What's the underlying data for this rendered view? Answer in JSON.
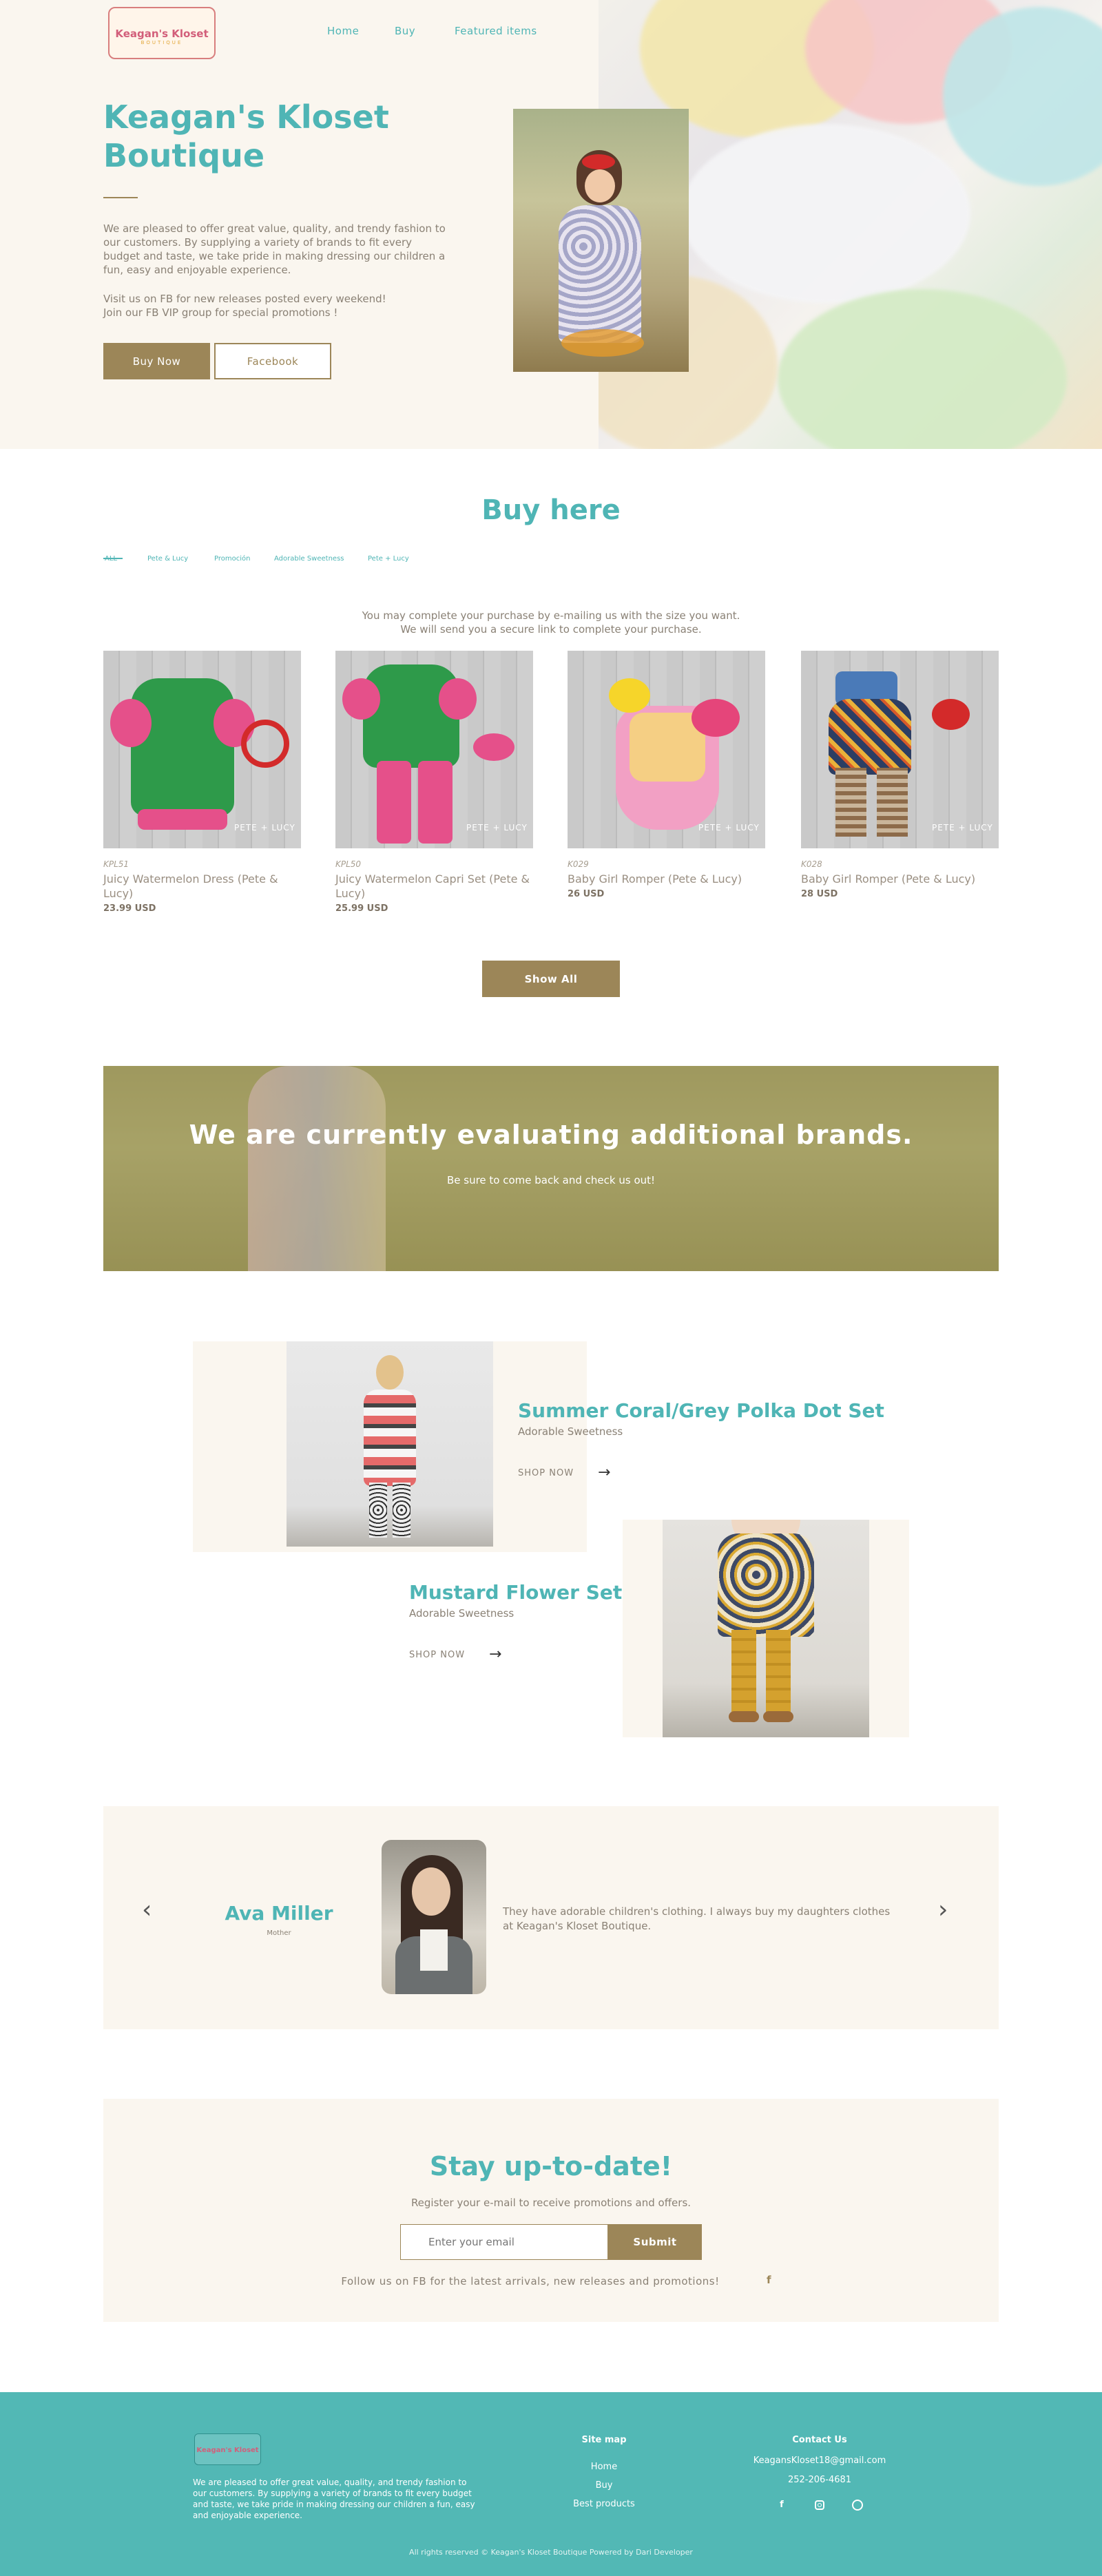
{
  "header": {
    "logo_text": "Keagan's Kloset",
    "logo_sub": "BOUTIQUE",
    "nav": [
      "Home",
      "Buy",
      "Featured items"
    ]
  },
  "hero": {
    "title_line1": "Keagan's Kloset",
    "title_line2": "Boutique",
    "desc": "We are pleased to offer great value, quality, and trendy fashion to our customers. By supplying a variety of brands to fit every budget and taste, we take pride in making dressing our children a fun, easy and enjoyable experience.",
    "desc2_line1": "Visit us on FB for new releases posted every weekend!",
    "desc2_line2": "Join our FB VIP group for special promotions !",
    "buy_now": "Buy Now",
    "facebook": "Facebook"
  },
  "buy": {
    "heading": "Buy here",
    "tabs": [
      "ALL",
      "Pete & Lucy",
      "Promoción",
      "Adorable Sweetness",
      "Pete + Lucy"
    ],
    "note_line1": "You may complete your purchase by e-mailing us with the size you want.",
    "note_line2": "We will send you a secure link to complete your purchase.",
    "products": [
      {
        "sku": "KPL51",
        "name": "Juicy Watermelon Dress (Pete & Lucy)",
        "price": "23.99 USD"
      },
      {
        "sku": "KPL50",
        "name": "Juicy Watermelon Capri Set (Pete & Lucy)",
        "price": "25.99 USD"
      },
      {
        "sku": "K029",
        "name": "Baby Girl Romper (Pete & Lucy)",
        "price": "26 USD"
      },
      {
        "sku": "K028",
        "name": "Baby Girl Romper (Pete & Lucy)",
        "price": "28 USD"
      }
    ],
    "watermark": "PETE + LUCY",
    "show_all": "Show All"
  },
  "banner": {
    "title": "We are currently evaluating additional brands.",
    "sub": "Be sure to come back and check us out!"
  },
  "featured": [
    {
      "title": "Summer Coral/Grey Polka Dot Set",
      "sub": "Adorable Sweetness",
      "cta": "SHOP NOW"
    },
    {
      "title": "Mustard Flower Set",
      "sub": "Adorable Sweetness",
      "cta": "SHOP NOW"
    }
  ],
  "testimonial": {
    "name": "Ava Miller",
    "role": "Mother",
    "quote": "They have adorable children's clothing. I always buy my daughters clothes at Keagan's Kloset Boutique."
  },
  "newsletter": {
    "heading": "Stay up-to-date!",
    "sub": "Register your e-mail to receive promotions and offers.",
    "placeholder": "Enter your email",
    "submit": "Submit",
    "follow": "Follow us on FB for the latest arrivals, new releases and promotions!"
  },
  "footer": {
    "about": "We are pleased to offer great value, quality, and trendy fashion to our customers. By supplying a variety of brands to fit every budget and taste, we take pride in making dressing our children a fun, easy and enjoyable experience.",
    "sitemap_title": "Site map",
    "sitemap": [
      "Home",
      "Buy",
      "Best products"
    ],
    "contact_title": "Contact Us",
    "email": "KeagansKloset18@gmail.com",
    "phone": "252-206-4681",
    "copyright": "All rights reserved © Keagan's Kloset Boutique Powered by Dari Developer"
  },
  "colors": {
    "teal": "#4fb5b5",
    "tan": "#9c8658",
    "cream": "#faf6ef",
    "footer": "#52b8b5"
  }
}
